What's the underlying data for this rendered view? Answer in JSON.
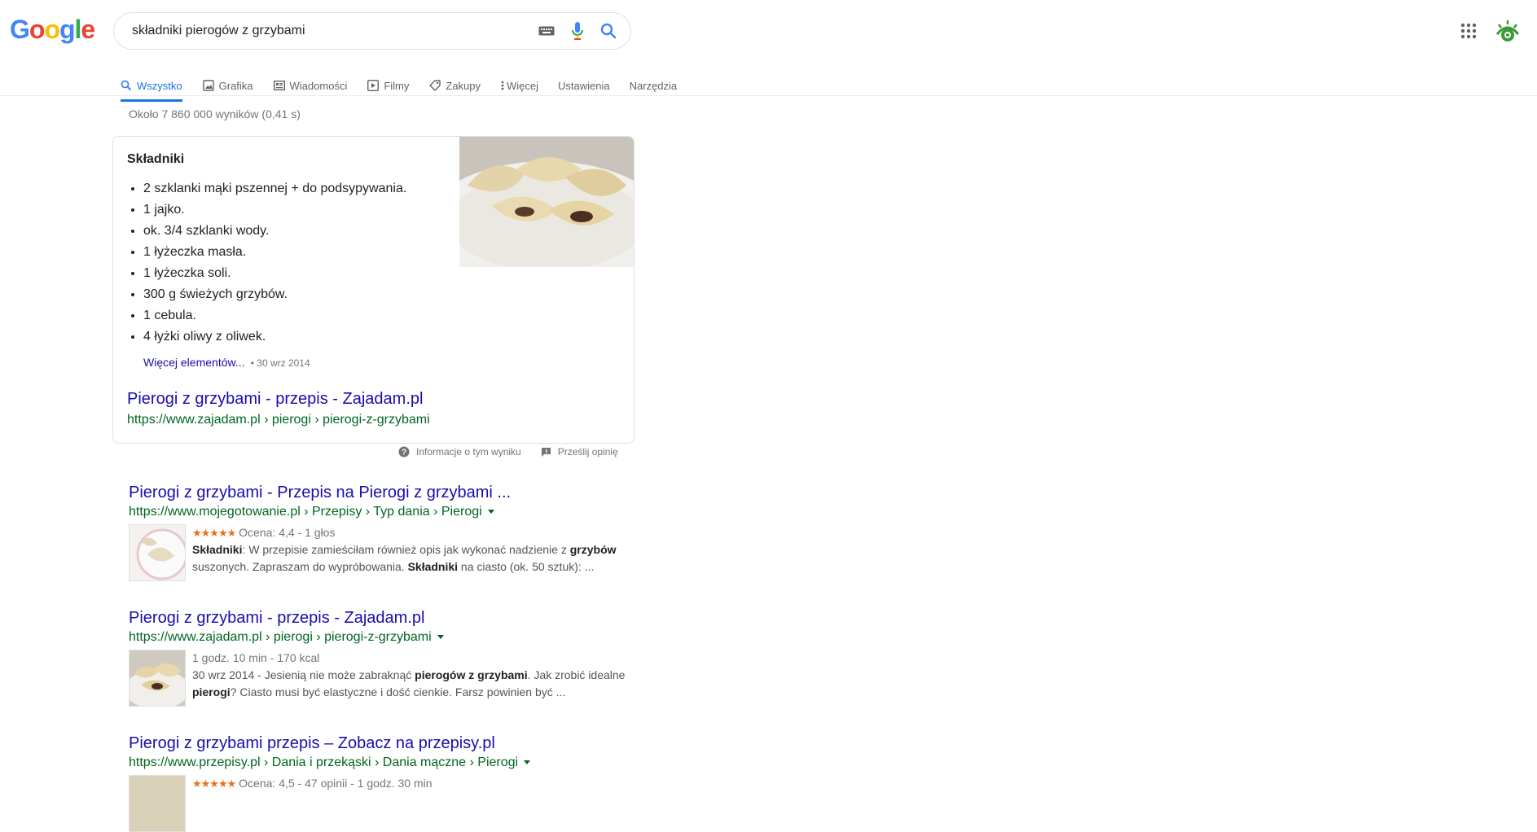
{
  "header": {
    "logo_letters": [
      "G",
      "o",
      "o",
      "g",
      "l",
      "e"
    ],
    "search_value": "składniki pierogów z grzybami"
  },
  "tabs": [
    {
      "label": "Wszystko",
      "icon": "search-icon",
      "active": true
    },
    {
      "label": "Grafika",
      "icon": "image-icon"
    },
    {
      "label": "Wiadomości",
      "icon": "news-icon"
    },
    {
      "label": "Filmy",
      "icon": "play-icon"
    },
    {
      "label": "Zakupy",
      "icon": "tag-icon"
    },
    {
      "label": "Więcej",
      "icon": "more-vert-icon"
    },
    {
      "label": "Ustawienia"
    },
    {
      "label": "Narzędzia"
    }
  ],
  "result_stats": "Około 7 860 000 wyników (0,41 s)",
  "featured": {
    "title": "Składniki",
    "items": [
      "2 szklanki mąki pszennej + do podsypywania.",
      "1 jajko.",
      "ok. 3/4 szklanki wody.",
      "1 łyżeczka masła.",
      "1 łyżeczka soli.",
      "300 g świeżych grzybów.",
      "1 cebula.",
      "4 łyżki oliwy z oliwek."
    ],
    "more_label": "Więcej elementów...",
    "date": "30 wrz 2014",
    "link_title": "Pierogi z grzybami - przepis - Zajadam.pl",
    "url": "https://www.zajadam.pl › pierogi › pierogi-z-grzybami"
  },
  "feedback": {
    "about_label": "Informacje o tym wyniku",
    "send_label": "Prześlij opinię"
  },
  "results": [
    {
      "title": "Pierogi z grzybami - Przepis na Pierogi z grzybami ...",
      "url": "https://www.mojegotowanie.pl › Przepisy › Typ dania › Pierogi",
      "stars": "★★★★★",
      "meta": "Ocena: 4,4 - 1 głos",
      "snippet_bold_1": "Składniki",
      "snippet_1": ": W przepisie zamieściłam również opis jak wykonać nadzienie z ",
      "snippet_bold_2": "grzybów",
      "snippet_2": " suszonych. Zapraszam do wypróbowania. ",
      "snippet_bold_3": "Składniki",
      "snippet_3": " na ciasto (ok. 50 sztuk): ..."
    },
    {
      "title": "Pierogi z grzybami - przepis - Zajadam.pl",
      "url": "https://www.zajadam.pl › pierogi › pierogi-z-grzybami",
      "meta": "1 godz. 10 min - 170 kcal",
      "snippet_1": "30 wrz 2014 - Jesienią nie może zabraknąć ",
      "snippet_bold_1": "pierogów z grzybami",
      "snippet_2": ". Jak zrobić idealne ",
      "snippet_bold_2": "pierogi",
      "snippet_3": "? Ciasto musi być elastyczne i dość cienkie. Farsz powinien być ..."
    },
    {
      "title": "Pierogi z grzybami przepis – Zobacz na przepisy.pl",
      "url": "https://www.przepisy.pl › Dania i przekąski › Dania mączne › Pierogi",
      "stars": "★★★★★",
      "meta": "Ocena: 4,5 - 47 opinii - 1 godz. 30 min"
    }
  ],
  "colors": {
    "link": "#1a0dab",
    "url_green": "#006621",
    "accent_blue": "#1a73e8",
    "star_orange": "#e7711b"
  }
}
